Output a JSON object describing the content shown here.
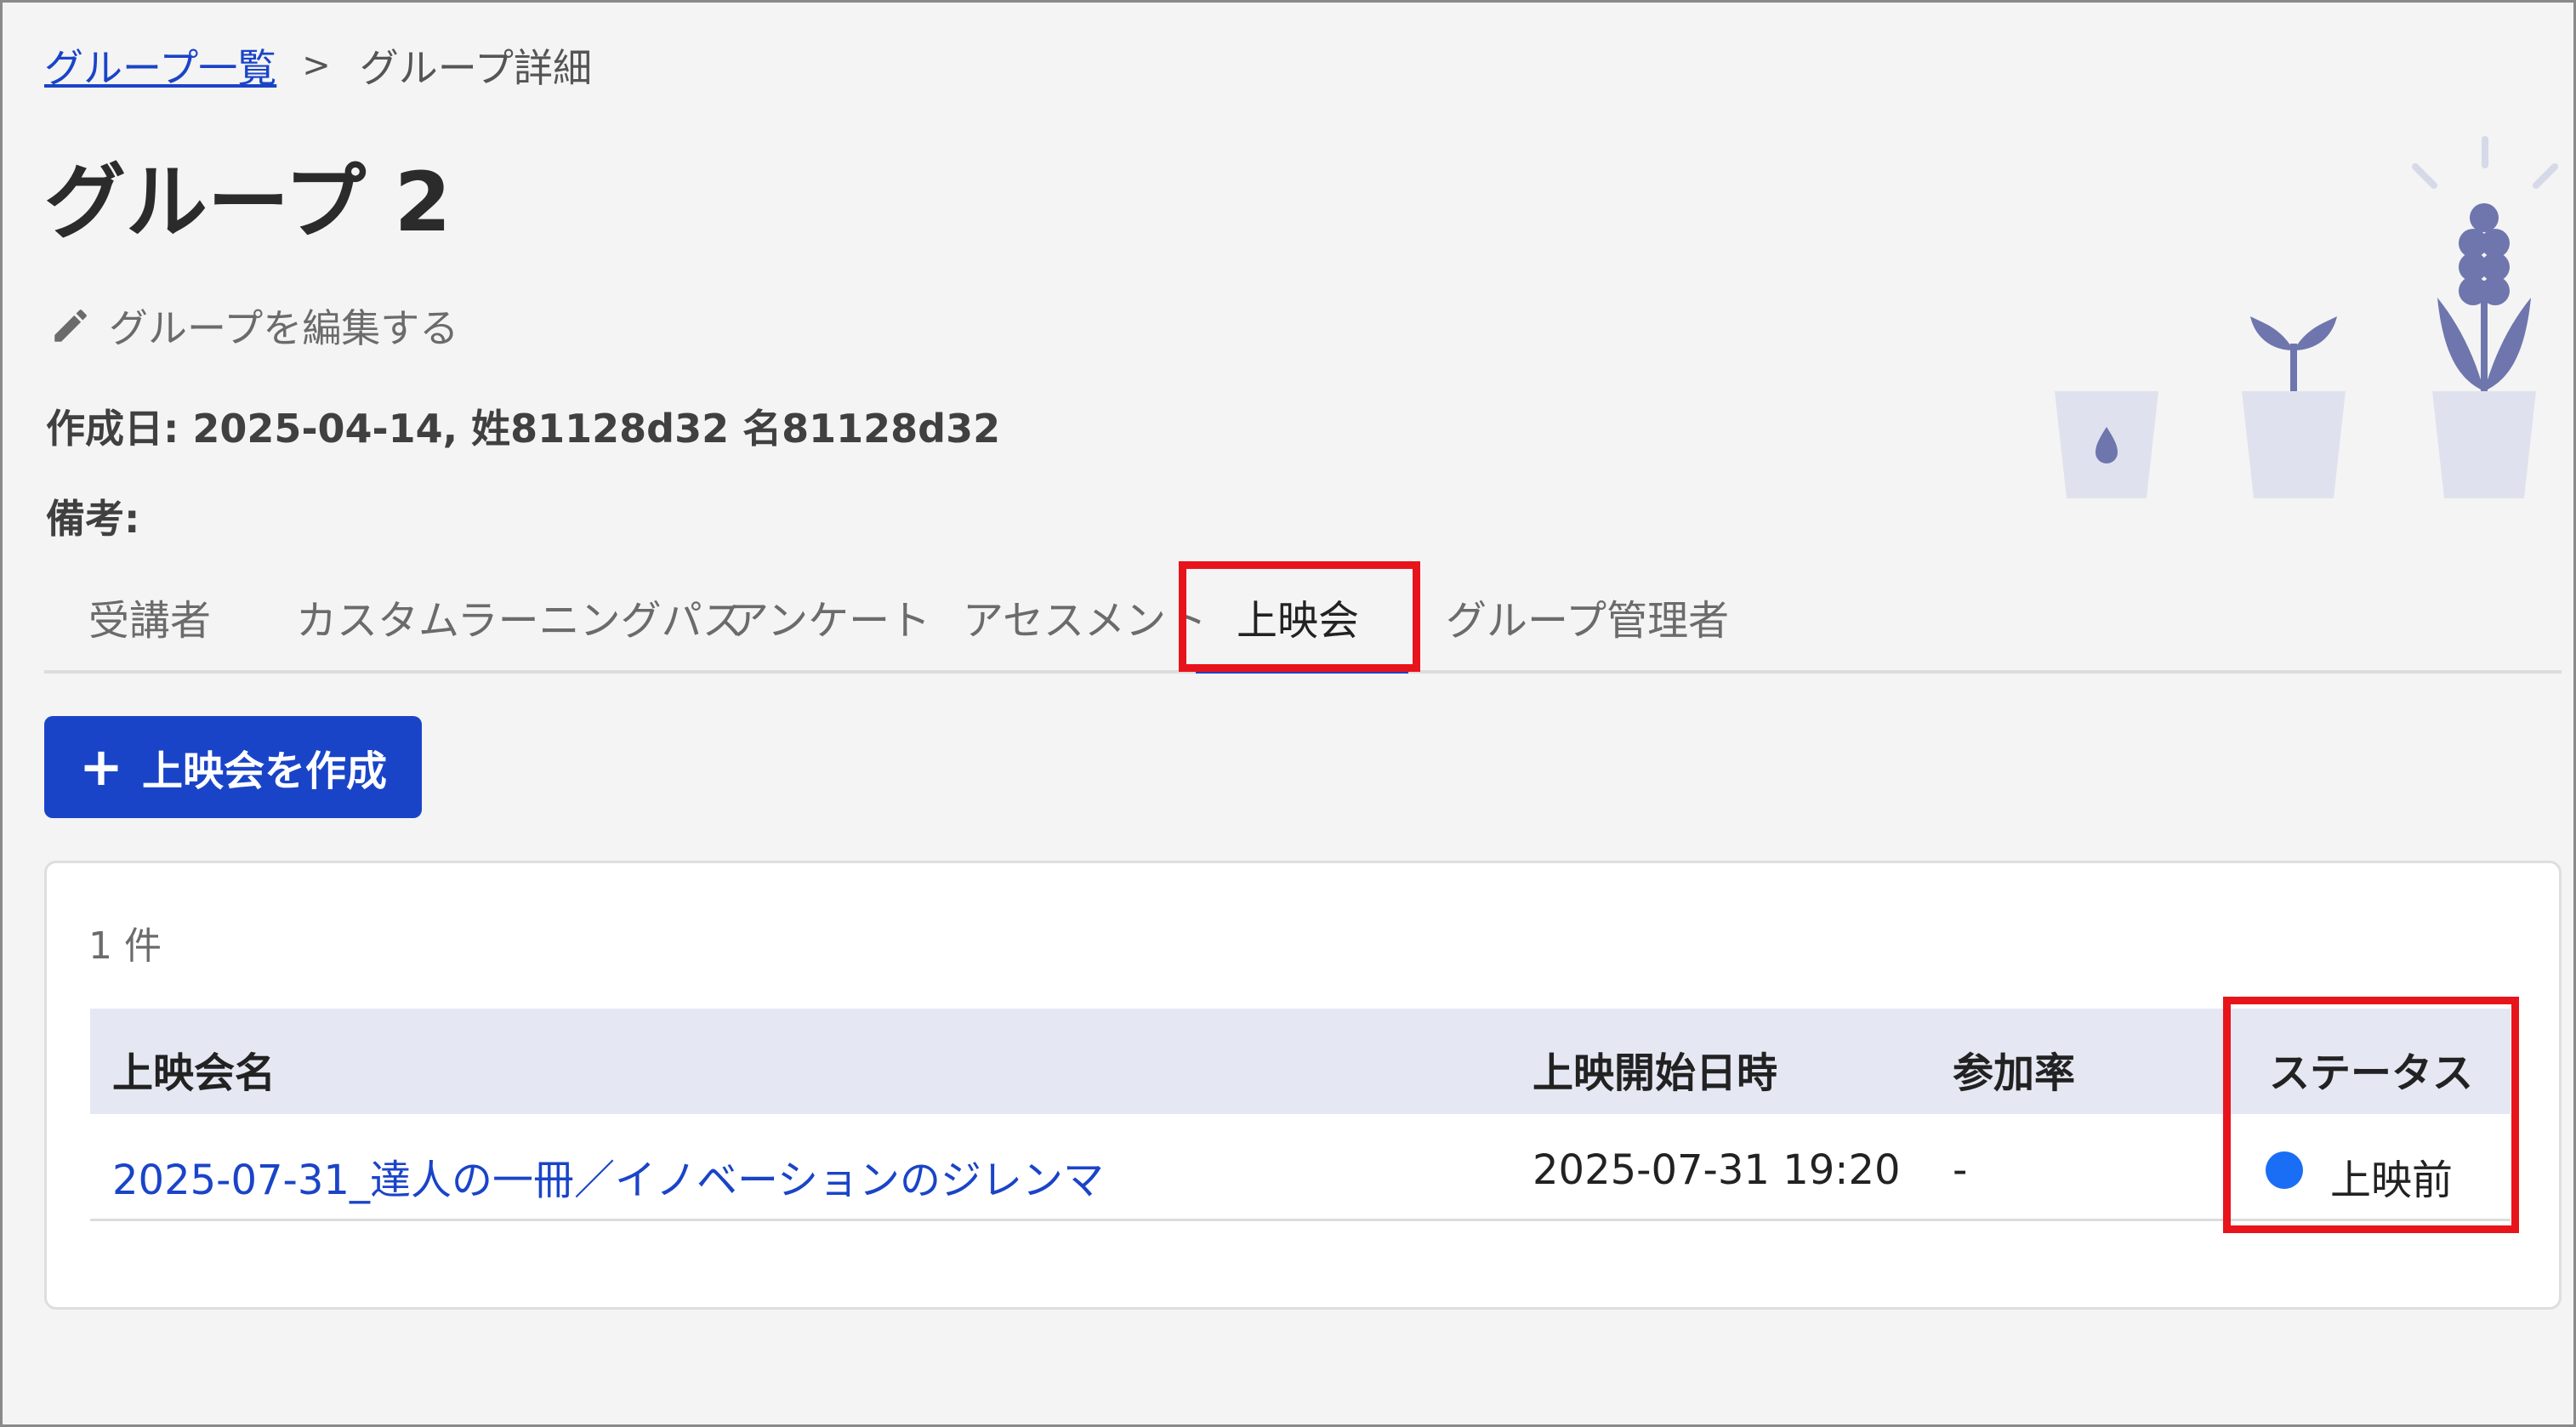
{
  "breadcrumb": {
    "parent_label": "グループ一覧",
    "separator": ">",
    "current_label": "グループ詳細"
  },
  "page": {
    "title": "グループ 2",
    "edit_label": "グループを編集する",
    "meta": "作成日: 2025-04-14, 姓81128d32 名81128d32",
    "remarks_label": "備考:"
  },
  "tabs": [
    {
      "label": "受講者",
      "active": false
    },
    {
      "label": "カスタムラーニングパス",
      "active": false
    },
    {
      "label": "アンケート",
      "active": false
    },
    {
      "label": "アセスメント",
      "active": false
    },
    {
      "label": "上映会",
      "active": true
    },
    {
      "label": "グループ管理者",
      "active": false
    }
  ],
  "actions": {
    "create_icon": "plus-icon",
    "create_label": "上映会を作成"
  },
  "table": {
    "count_label": "1 件",
    "columns": [
      "上映会名",
      "上映開始日時",
      "参加率",
      "ステータス"
    ],
    "rows": [
      {
        "name": "2025-07-31_達人の一冊／イノベーションのジレンマ",
        "start": "2025-07-31 19:20",
        "rate": "-",
        "status": "上映前",
        "status_color": "#1a6ef5"
      }
    ]
  },
  "icons": {
    "edit": "pencil-icon",
    "illustration": "potted-plants-illustration"
  },
  "colors": {
    "accent": "#1a44c8",
    "highlight_box": "#e8141c",
    "table_header_bg": "#e5e8f2",
    "illustration": "#6e76ad"
  }
}
